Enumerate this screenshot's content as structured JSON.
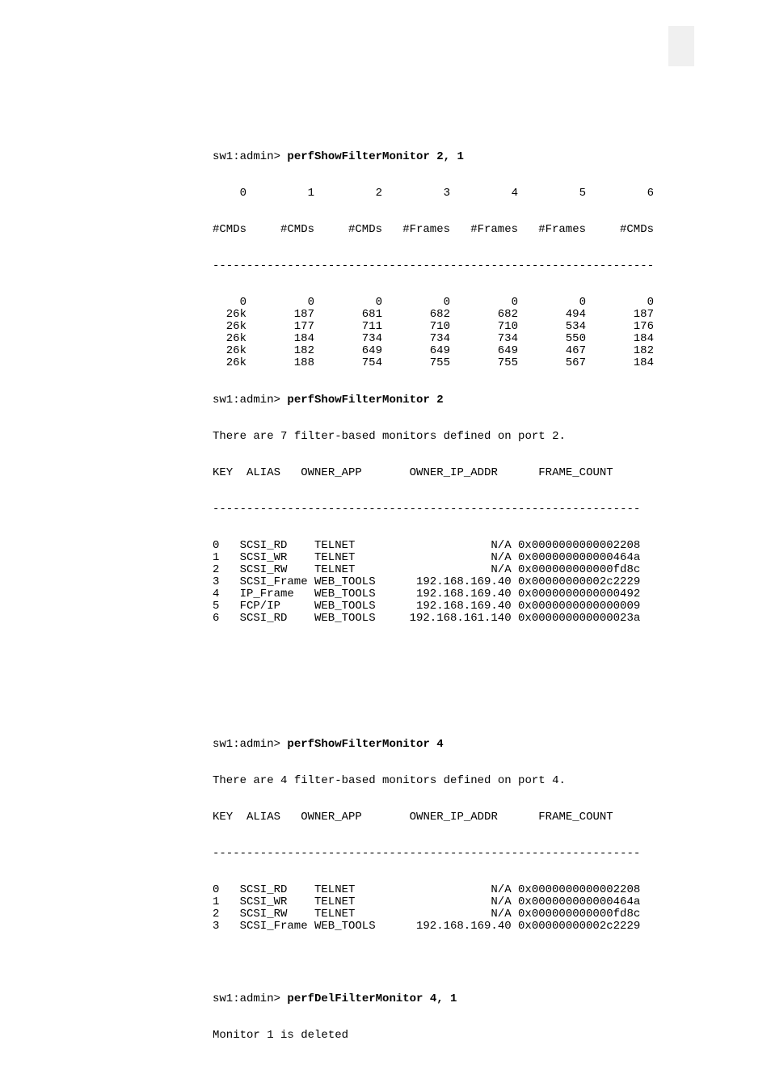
{
  "block1": {
    "prompt": "sw1:admin> ",
    "command": "perfShowFilterMonitor 2, 1",
    "header_indices": [
      "0",
      "1",
      "2",
      "3",
      "4",
      "5",
      "6"
    ],
    "header_labels": [
      "#CMDs",
      "#CMDs",
      "#CMDs",
      "#Frames",
      "#Frames",
      "#Frames",
      "#CMDs"
    ],
    "divider": "-----------------------------------------------------------------",
    "rows": [
      [
        "0",
        "0",
        "0",
        "0",
        "0",
        "0",
        "0"
      ],
      [
        "26k",
        "187",
        "681",
        "682",
        "682",
        "494",
        "187"
      ],
      [
        "26k",
        "177",
        "711",
        "710",
        "710",
        "534",
        "176"
      ],
      [
        "26k",
        "184",
        "734",
        "734",
        "734",
        "550",
        "184"
      ],
      [
        "26k",
        "182",
        "649",
        "649",
        "649",
        "467",
        "182"
      ],
      [
        "26k",
        "188",
        "754",
        "755",
        "755",
        "567",
        "184"
      ]
    ]
  },
  "block2": {
    "prompt": "sw1:admin> ",
    "command": "perfShowFilterMonitor 2",
    "intro": "There are 7 filter-based monitors defined on port 2.",
    "header": "KEY  ALIAS   OWNER_APP       OWNER_IP_ADDR      FRAME_COUNT",
    "divider": "---------------------------------------------------------------",
    "rows": [
      [
        "0",
        "SCSI_RD",
        "TELNET",
        "N/A",
        "0x0000000000002208"
      ],
      [
        "1",
        "SCSI_WR",
        "TELNET",
        "N/A",
        "0x000000000000464a"
      ],
      [
        "2",
        "SCSI_RW",
        "TELNET",
        "N/A",
        "0x000000000000fd8c"
      ],
      [
        "3",
        "SCSI_Frame",
        "WEB_TOOLS",
        "192.168.169.40",
        "0x00000000002c2229"
      ],
      [
        "4",
        "IP_Frame",
        "WEB_TOOLS",
        "192.168.169.40",
        "0x0000000000000492"
      ],
      [
        "5",
        "FCP/IP",
        "WEB_TOOLS",
        "192.168.169.40",
        "0x0000000000000009"
      ],
      [
        "6",
        "SCSI_RD",
        "WEB_TOOLS",
        "192.168.161.140",
        "0x000000000000023a"
      ]
    ]
  },
  "block3": {
    "prompt1": "sw1:admin> ",
    "command1": "perfShowFilterMonitor 4",
    "intro": "There are 4 filter-based monitors defined on port 4.",
    "header": "KEY  ALIAS   OWNER_APP       OWNER_IP_ADDR      FRAME_COUNT",
    "divider": "---------------------------------------------------------------",
    "rows": [
      [
        "0",
        "SCSI_RD",
        "TELNET",
        "N/A",
        "0x0000000000002208"
      ],
      [
        "1",
        "SCSI_WR",
        "TELNET",
        "N/A",
        "0x000000000000464a"
      ],
      [
        "2",
        "SCSI_RW",
        "TELNET",
        "N/A",
        "0x000000000000fd8c"
      ],
      [
        "3",
        "SCSI_Frame",
        "WEB_TOOLS",
        "192.168.169.40",
        "0x00000000002c2229"
      ]
    ],
    "prompt2": "sw1:admin> ",
    "command2": "perfDelFilterMonitor 4, 1",
    "result": "Monitor 1 is deleted"
  }
}
